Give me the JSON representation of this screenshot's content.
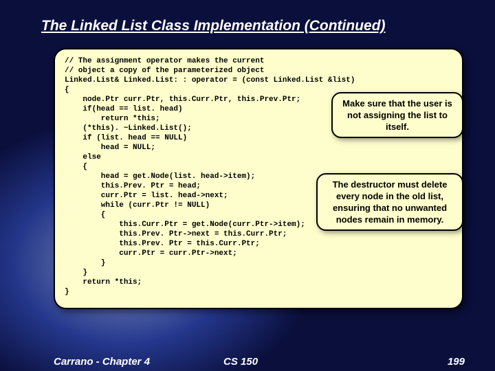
{
  "title": "The Linked List Class Implementation (Continued)",
  "code": "// The assignment operator makes the current\n// object a copy of the parameterized object\nLinked.List& Linked.List: : operator = (const Linked.List &list)\n{\n    node.Ptr curr.Ptr, this.Curr.Ptr, this.Prev.Ptr;\n    if(head == list. head)\n        return *this;\n    (*this). ~Linked.List();\n    if (list. head == NULL)\n        head = NULL;\n    else\n    {\n        head = get.Node(list. head->item);\n        this.Prev. Ptr = head;\n        curr.Ptr = list. head->next;\n        while (curr.Ptr != NULL)\n        {\n            this.Curr.Ptr = get.Node(curr.Ptr->item);\n            this.Prev. Ptr->next = this.Curr.Ptr;\n            this.Prev. Ptr = this.Curr.Ptr;\n            curr.Ptr = curr.Ptr->next;\n        }\n    }\n    return *this;\n}",
  "callouts": {
    "self_assign": "Make sure that the user is not assigning the list to itself.",
    "destructor": "The destructor must delete every node in the old list, ensuring that no unwanted nodes remain in memory."
  },
  "footer": {
    "left": "Carrano - Chapter 4",
    "middle": "CS 150",
    "right": "199"
  }
}
